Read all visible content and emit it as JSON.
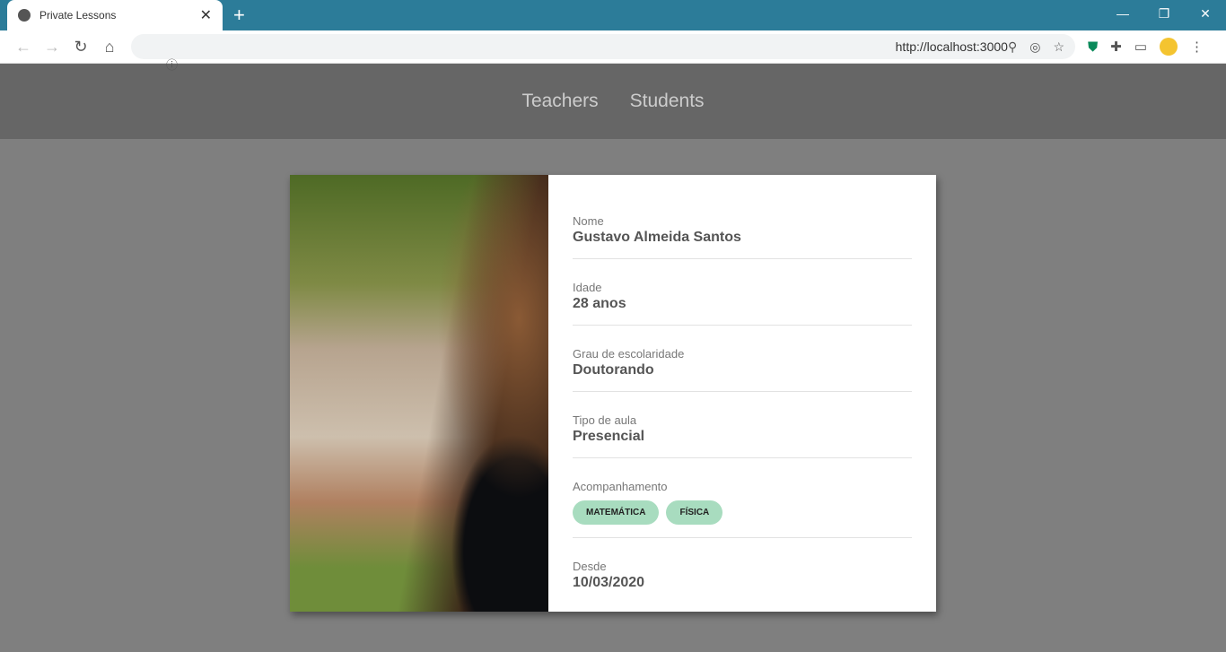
{
  "browser": {
    "tab_title": "Private Lessons",
    "url": "http://localhost:3000"
  },
  "nav": {
    "teachers": "Teachers",
    "students": "Students"
  },
  "profile": {
    "fields": [
      {
        "label": "Nome",
        "value": "Gustavo Almeida Santos"
      },
      {
        "label": "Idade",
        "value": "28 anos"
      },
      {
        "label": "Grau de escolaridade",
        "value": "Doutorando"
      },
      {
        "label": "Tipo de aula",
        "value": "Presencial"
      }
    ],
    "subjects_label": "Acompanhamento",
    "subjects": [
      "MATEMÁTICA",
      "FÍSICA"
    ],
    "since_label": "Desde",
    "since": "10/03/2020"
  }
}
